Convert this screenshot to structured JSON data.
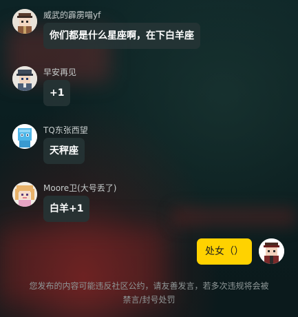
{
  "messages": [
    {
      "name": "威武的霹雳喵yf",
      "text": "你们都是什么星座啊，在下白羊座",
      "avatar_icon": "avatar-icon"
    },
    {
      "name": "早安再见",
      "text": "+1",
      "avatar_icon": "avatar-icon"
    },
    {
      "name": "TQ东张西望",
      "text": "天秤座",
      "avatar_icon": "avatar-icon"
    },
    {
      "name": "Moore卫(大号丢了)",
      "text": "白羊+1",
      "avatar_icon": "avatar-icon"
    }
  ],
  "self_message": {
    "text": "处女（）"
  },
  "notice": {
    "line1": "您发布的内容可能违反社区公约，请友善发言，若多次违规将会被",
    "line2": "禁言/封号处罚"
  },
  "colors": {
    "self_bubble": "#ffd200",
    "other_bubble": "#263436",
    "name_text": "#c7cdcd",
    "notice_text": "#8f9797"
  }
}
